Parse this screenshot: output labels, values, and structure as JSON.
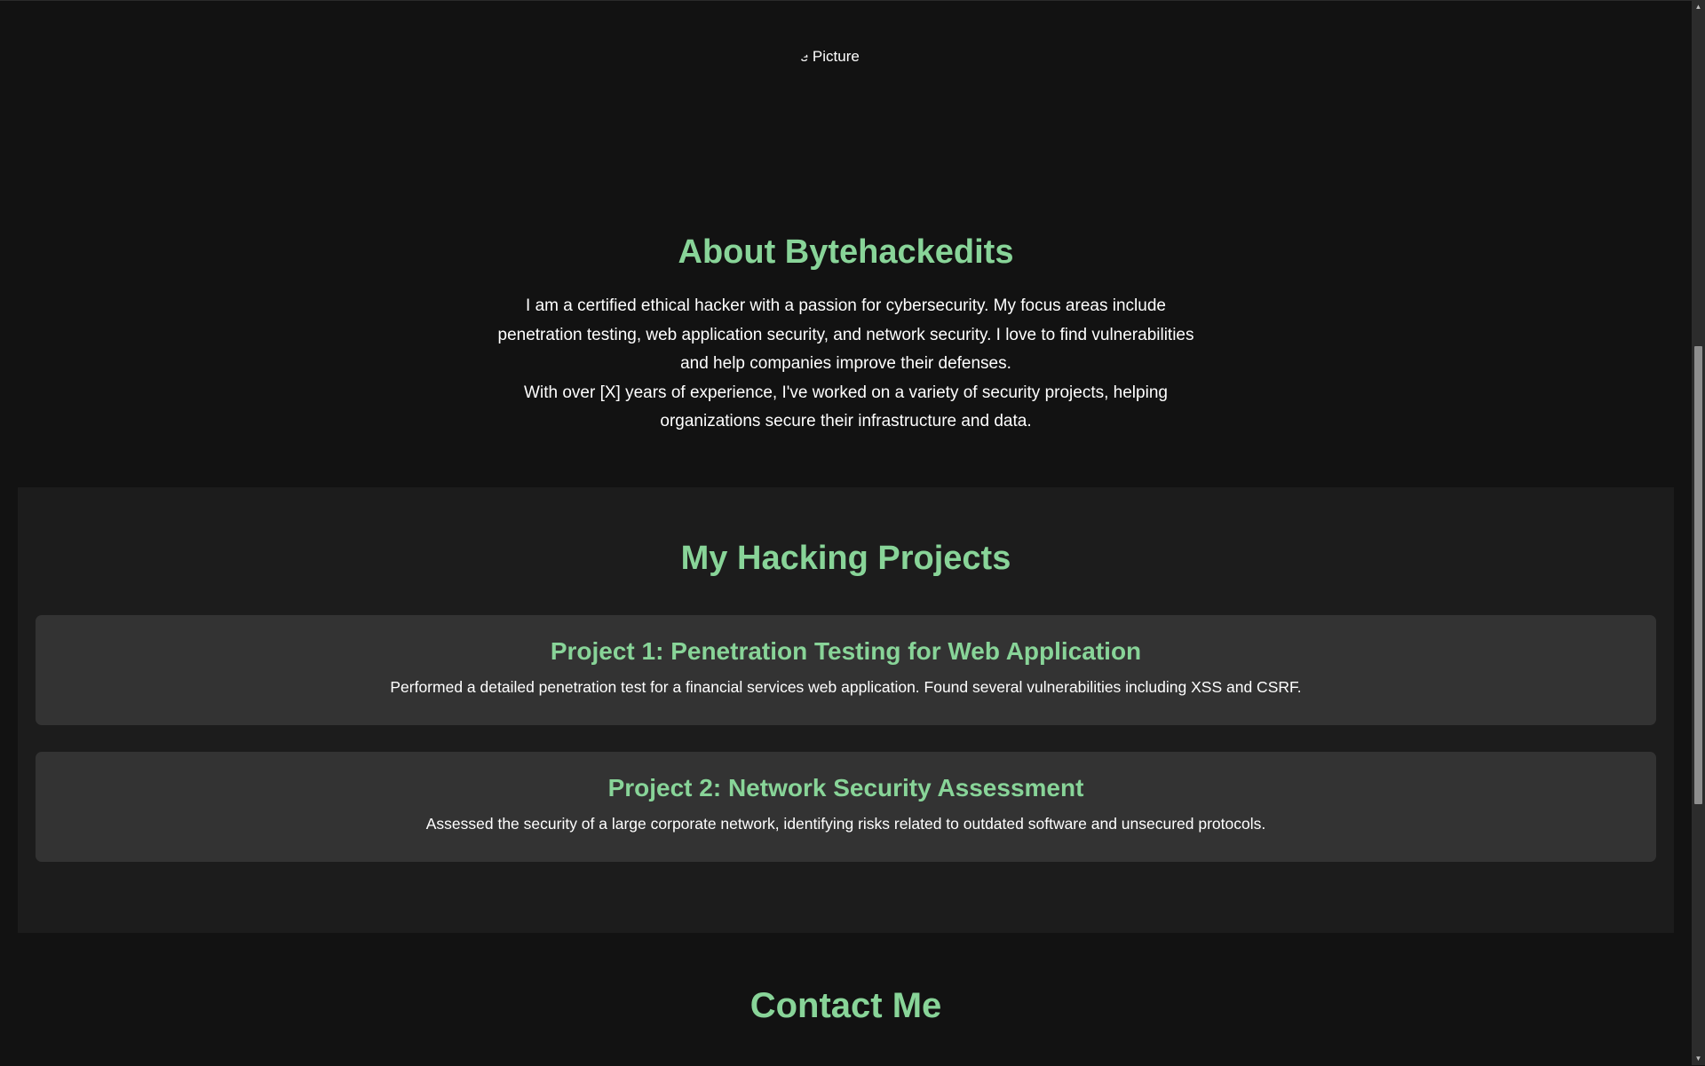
{
  "profile": {
    "image_alt": "Profile Picture"
  },
  "about": {
    "title": "About Bytehackedits",
    "paragraph_1": "I am a certified ethical hacker with a passion for cybersecurity. My focus areas include penetration testing, web application security, and network security. I love to find vulnerabilities and help companies improve their defenses.",
    "paragraph_2": "With over [X] years of experience, I've worked on a variety of security projects, helping organizations secure their infrastructure and data."
  },
  "projects": {
    "title": "My Hacking Projects",
    "items": [
      {
        "title": "Project 1: Penetration Testing for Web Application",
        "description": "Performed a detailed penetration test for a financial services web application. Found several vulnerabilities including XSS and CSRF."
      },
      {
        "title": "Project 2: Network Security Assessment",
        "description": "Assessed the security of a large corporate network, identifying risks related to outdated software and unsecured protocols."
      }
    ]
  },
  "contact": {
    "title": "Contact Me"
  },
  "scrollbar": {
    "up_icon": "arrow-up-icon",
    "down_icon": "arrow-down-icon",
    "position_fraction": 0.33
  },
  "colors": {
    "background": "#121212",
    "section_background": "#1c1c1c",
    "card_background": "#333333",
    "accent": "#88d498",
    "text": "#ffffff"
  }
}
